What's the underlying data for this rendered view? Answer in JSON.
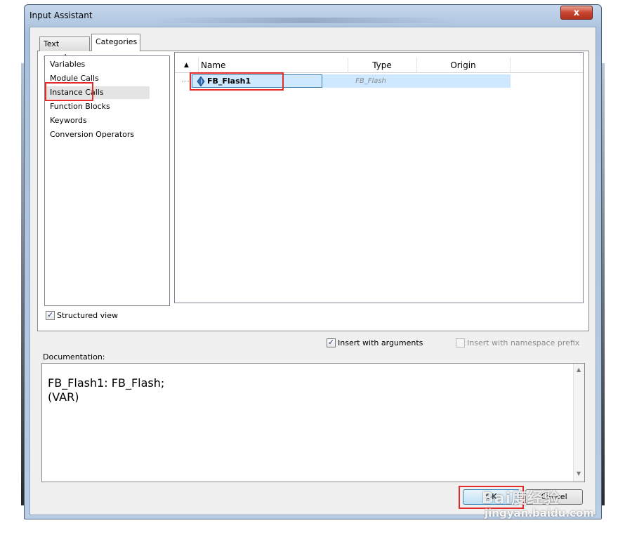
{
  "window": {
    "title": "Input Assistant",
    "close_glyph": "x"
  },
  "tabs": [
    {
      "label": "Text search",
      "active": false
    },
    {
      "label": "Categories",
      "active": true
    }
  ],
  "categories": {
    "items": [
      {
        "label": "Variables"
      },
      {
        "label": "Module Calls"
      },
      {
        "label": "Instance Calls",
        "selected": true
      },
      {
        "label": "Function Blocks"
      },
      {
        "label": "Keywords"
      },
      {
        "label": "Conversion Operators"
      }
    ]
  },
  "table": {
    "sort_glyph": "▲",
    "columns": {
      "name": "Name",
      "type": "Type",
      "origin": "Origin"
    },
    "rows": [
      {
        "name": "FB_Flash1",
        "type": "FB_Flash",
        "origin": "",
        "icon": "instance-icon"
      }
    ]
  },
  "options": {
    "structured_view": {
      "label": "Structured view",
      "checked": true
    },
    "insert_with_arguments": {
      "label": "Insert with arguments",
      "checked": true
    },
    "insert_with_namespace_prefix": {
      "label": "Insert with namespace prefix",
      "checked": false,
      "enabled": false
    }
  },
  "documentation": {
    "label": "Documentation:",
    "text": "FB_Flash1: FB_Flash;\n(VAR)"
  },
  "buttons": {
    "ok": "OK",
    "cancel": "Cancel"
  },
  "watermark": {
    "logo": "Bai度经验",
    "url": "jingyan.baidu.com"
  },
  "colors": {
    "highlight_box": "#e32b2b",
    "selection": "#cde8ff"
  }
}
